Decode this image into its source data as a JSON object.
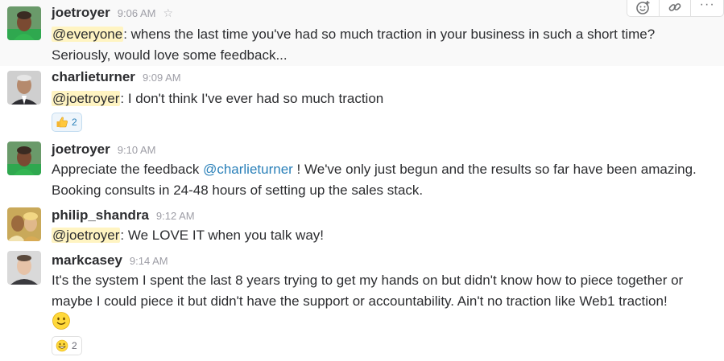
{
  "messages": [
    {
      "user": "joetroyer",
      "time": "9:06 AM",
      "star_icon": "☆",
      "mention": "@everyone",
      "text_line1": ": whens the last time you've had so much traction in your business in such a short time?",
      "text_line2": "Seriously, would love some feedback..."
    },
    {
      "user": "charlieturner",
      "time": "9:09 AM",
      "mention": "@joetroyer",
      "text": ": I don't think I've ever had so much traction",
      "reaction": {
        "icon": "thumbs-up-icon",
        "count": "2"
      }
    },
    {
      "user": "joetroyer",
      "time": "9:10 AM",
      "text_a": "Appreciate the feedback ",
      "link": "@charlieturner",
      "text_b": " ! We've only just begun and the results so far have been amazing.",
      "text_line2": "Booking consults in 24-48 hours of setting up the sales stack."
    },
    {
      "user": "philip_shandra",
      "time": "9:12 AM",
      "mention": "@joetroyer",
      "text": ": We LOVE IT when you talk way!"
    },
    {
      "user": "markcasey",
      "time": "9:14 AM",
      "text_line1": "It's the system I spent the last 8 years trying to get my hands on but didn't know how to piece together or",
      "text_line2": "maybe I could piece it but didn't have the support or accountability. Ain't no traction like Web1 traction!",
      "inline_emoji": "smile-emoji-icon",
      "reaction": {
        "icon": "grinning-emoji-icon",
        "count": "2"
      }
    }
  ],
  "message_actions": {
    "items": [
      "add-reaction-icon",
      "copy-link-icon",
      "more-actions-icon"
    ],
    "more_label": "···"
  },
  "colors": {
    "mention_bg": "#fff4c2",
    "link": "#2a80b9",
    "timestamp": "#9e9ea6",
    "hover_bg": "#f9f9f9"
  }
}
